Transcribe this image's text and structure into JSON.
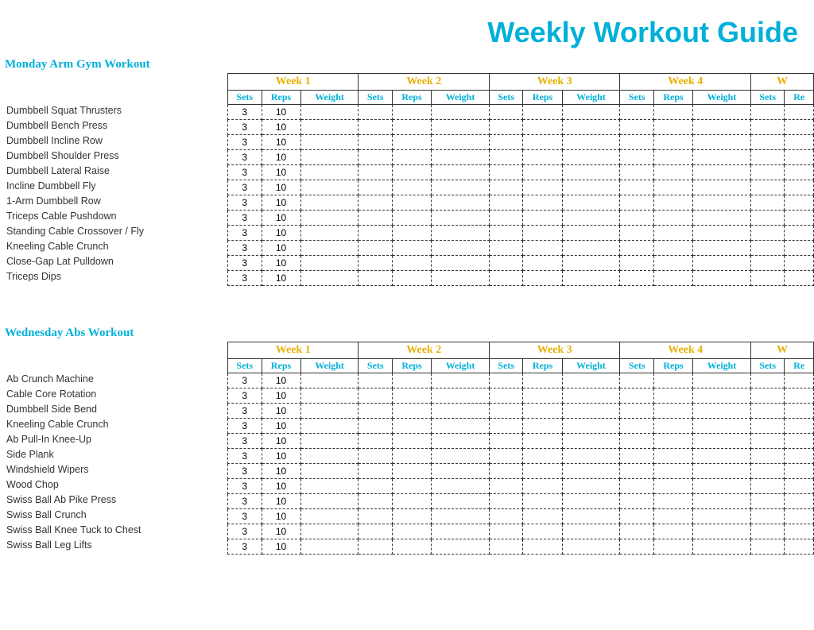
{
  "title": "Weekly Workout Guide",
  "weeks": [
    {
      "label": "Week 1",
      "cols": [
        "Sets",
        "Reps",
        "Weight"
      ]
    },
    {
      "label": "Week 2",
      "cols": [
        "Sets",
        "Reps",
        "Weight"
      ]
    },
    {
      "label": "Week 3",
      "cols": [
        "Sets",
        "Reps",
        "Weight"
      ]
    },
    {
      "label": "Week 4",
      "cols": [
        "Sets",
        "Reps",
        "Weight"
      ]
    },
    {
      "label": "W",
      "cols": [
        "Sets",
        "Re"
      ]
    }
  ],
  "section1": {
    "title": "Monday Arm Gym Workout",
    "exercises": [
      "Dumbbell Squat Thrusters",
      "Dumbbell Bench Press",
      "Dumbbell Incline Row",
      "Dumbbell Shoulder Press",
      "Dumbbell Lateral Raise",
      "Incline Dumbbell Fly",
      "1-Arm Dumbbell Row",
      "Triceps Cable Pushdown",
      "Standing Cable Crossover / Fly",
      "Kneeling Cable Crunch",
      "Close-Gap Lat Pulldown",
      "Triceps Dips"
    ],
    "defaultSets": 3,
    "defaultReps": 10
  },
  "section2": {
    "title": "Wednesday Abs Workout",
    "exercises": [
      "Ab Crunch Machine",
      "Cable Core Rotation",
      "Dumbbell Side Bend",
      "Kneeling Cable Crunch",
      "Ab Pull-In Knee-Up",
      "Side Plank",
      "Windshield Wipers",
      "Wood Chop",
      "Swiss Ball Ab Pike Press",
      "Swiss Ball Crunch",
      "Swiss Ball Knee Tuck to Chest",
      "Swiss Ball Leg Lifts"
    ],
    "defaultSets": 3,
    "defaultReps": 10
  },
  "colors": {
    "title": "#00b0d8",
    "weekHeader": "#e8b000",
    "columnHeader": "#00b0d8",
    "sectionTitle": "#00b0d8"
  }
}
